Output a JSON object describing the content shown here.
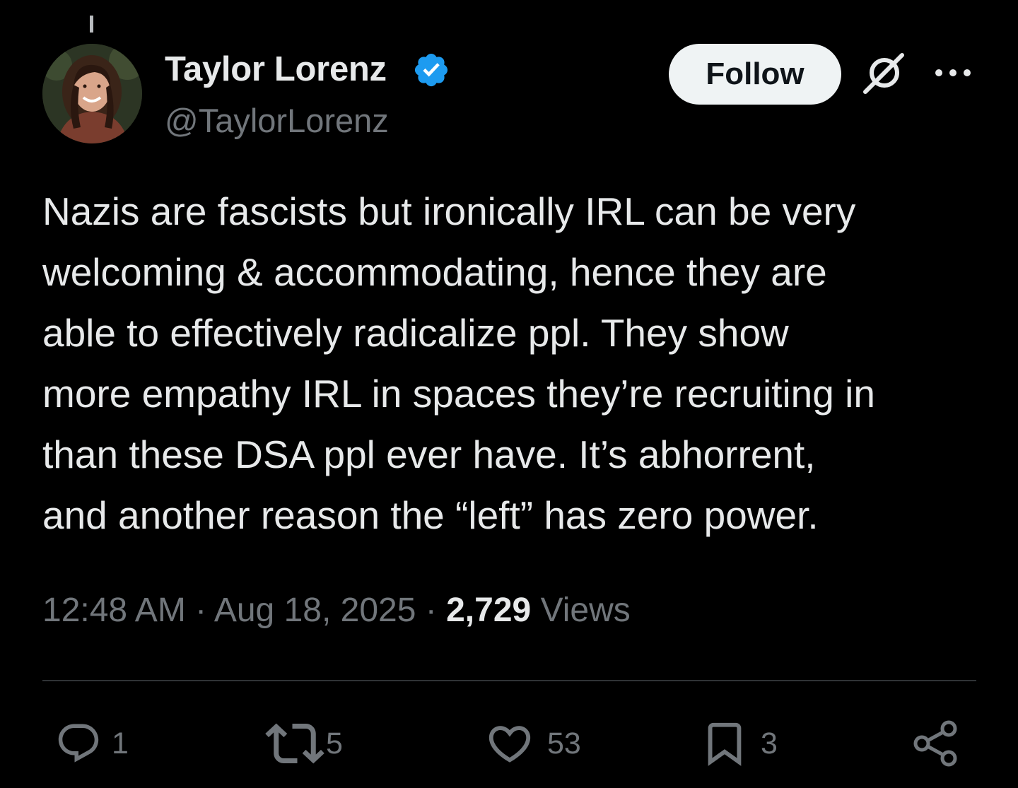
{
  "author": {
    "display_name": "Taylor Lorenz",
    "handle": "@TaylorLorenz",
    "verified": true,
    "verified_color": "#1d9bf0"
  },
  "header": {
    "follow_label": "Follow",
    "icons": [
      "grok-icon",
      "more-icon"
    ]
  },
  "tweet": {
    "lines": [
      "Nazis are fascists but ironically IRL can be very",
      "welcoming & accommodating, hence they are",
      "able to effectively radicalize ppl. They show",
      "more empathy IRL in spaces they’re recruiting in",
      "than these DSA ppl ever have. It’s abhorrent,",
      "and another reason the “left” has zero power."
    ],
    "time": "12:48 AM",
    "separator": "·",
    "date": "Aug 18, 2025",
    "views_count": "2,729",
    "views_label": "Views"
  },
  "actions": {
    "replies": "1",
    "reposts": "5",
    "likes": "53",
    "bookmarks": "3"
  },
  "colors": {
    "background": "#000000",
    "text": "#e7e9ea",
    "secondary": "#71767b",
    "divider": "#2f3336",
    "button_bg": "#eff3f4"
  }
}
